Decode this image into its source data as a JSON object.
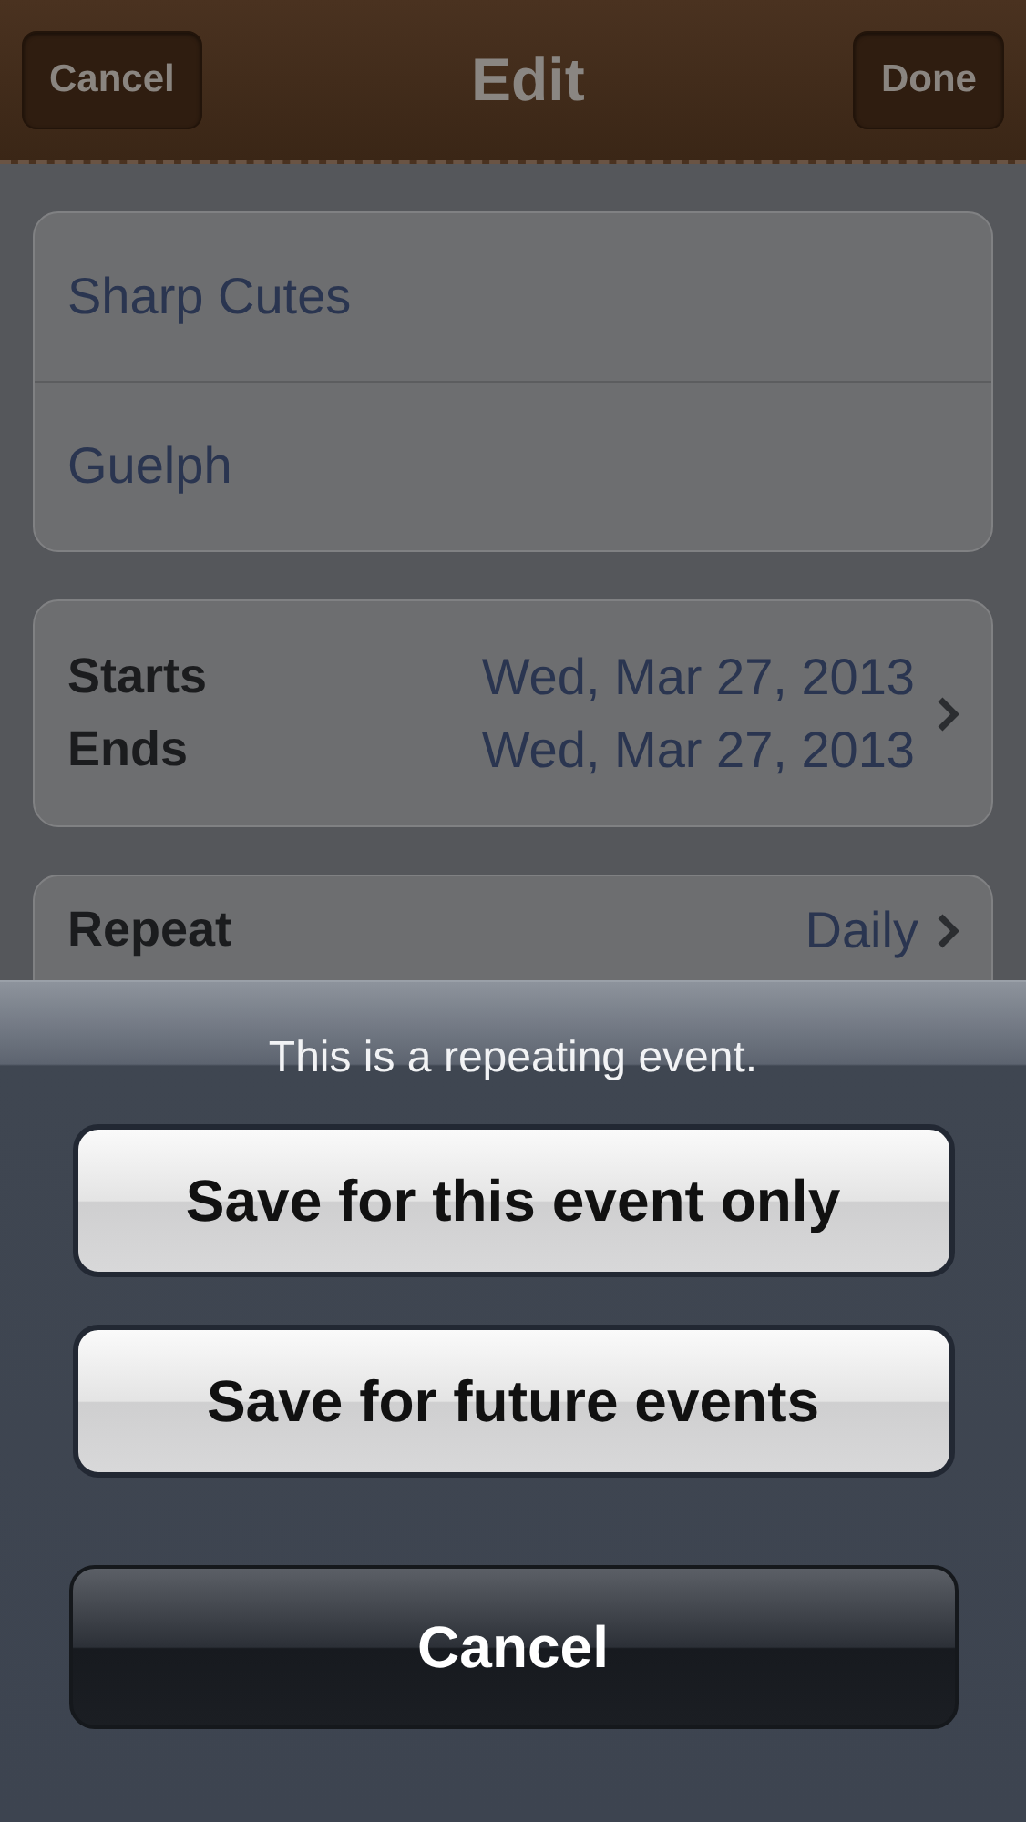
{
  "nav_bar": {
    "title": "Edit",
    "left_button": "Cancel",
    "right_button": "Done"
  },
  "event": {
    "title": "Sharp Cutes",
    "location": "Guelph"
  },
  "dates": [
    {
      "label": "Starts",
      "value": "Wed, Mar 27, 2013"
    },
    {
      "label": "Ends",
      "value": "Wed, Mar 27, 2013"
    }
  ],
  "repeat": {
    "label": "Repeat",
    "value": "Daily"
  },
  "action_sheet": {
    "message": "This is a repeating event.",
    "buttons": [
      {
        "label": "Save for this event only",
        "kind": "default"
      },
      {
        "label": "Save for future events",
        "kind": "default"
      },
      {
        "label": "Cancel",
        "kind": "cancel"
      }
    ]
  }
}
